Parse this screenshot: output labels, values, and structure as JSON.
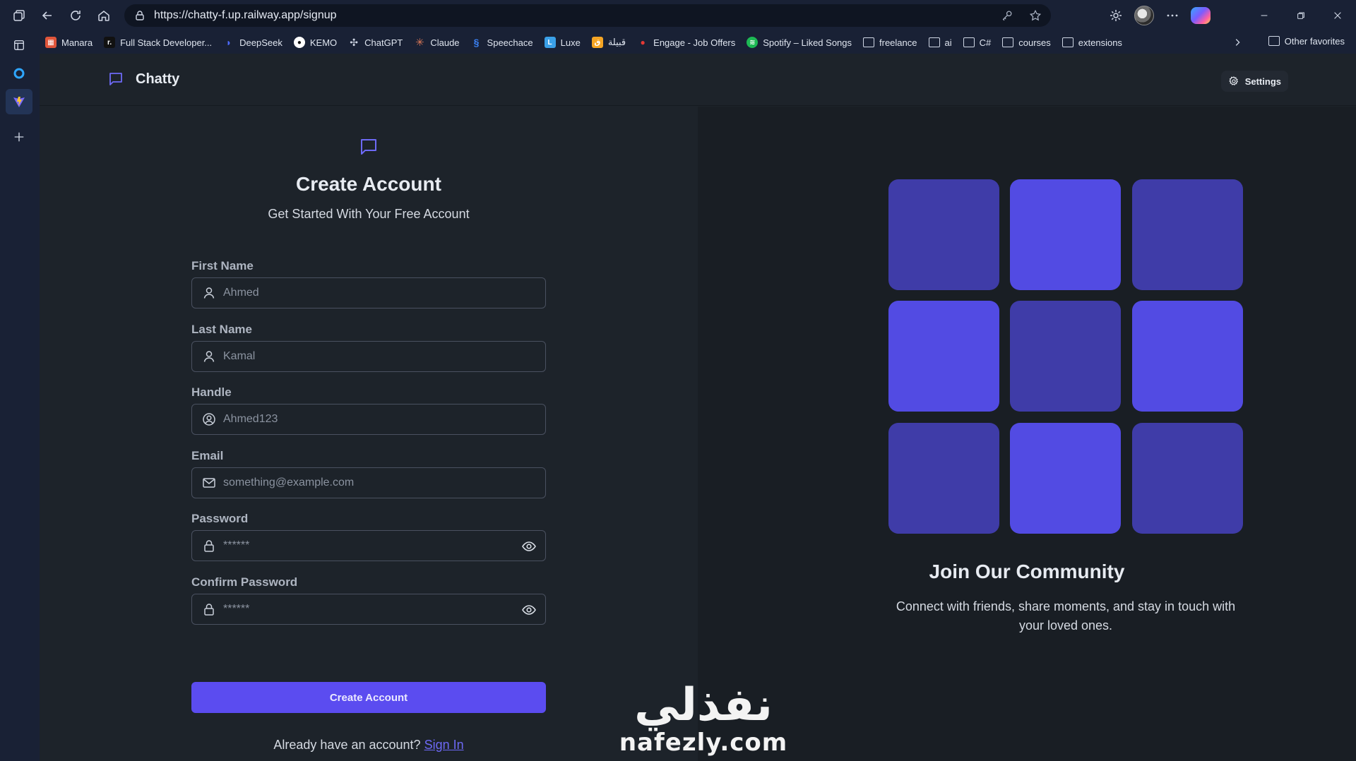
{
  "browser": {
    "url": "https://chatty-f.up.railway.app/signup",
    "bookmarks": [
      {
        "label": "Manara",
        "icon": "manara-icon",
        "color": "#e0553a"
      },
      {
        "label": "Full Stack Developer...",
        "icon": "r-icon",
        "color": "#111111"
      },
      {
        "label": "DeepSeek",
        "icon": "deepseek-icon",
        "color": "#4d6bfe"
      },
      {
        "label": "KEMO",
        "icon": "github-icon",
        "color": "#ffffff"
      },
      {
        "label": "ChatGPT",
        "icon": "chatgpt-icon",
        "color": "#cfd6e4"
      },
      {
        "label": "Claude",
        "icon": "claude-icon",
        "color": "#d97757"
      },
      {
        "label": "Speechace",
        "icon": "speechace-icon",
        "color": "#3b82f6"
      },
      {
        "label": "Luxe",
        "icon": "luxe-icon",
        "color": "#3aa0e8"
      },
      {
        "label": "قبيلة",
        "icon": "qabila-icon",
        "color": "#f5a524"
      },
      {
        "label": "Engage - Job Offers",
        "icon": "engage-icon",
        "color": "#e53935"
      },
      {
        "label": "Spotify – Liked Songs",
        "icon": "spotify-icon",
        "color": "#1db954"
      },
      {
        "label": "freelance",
        "icon": "folder-icon"
      },
      {
        "label": "ai",
        "icon": "folder-icon"
      },
      {
        "label": "C#",
        "icon": "folder-icon"
      },
      {
        "label": "courses",
        "icon": "folder-icon"
      },
      {
        "label": "extensions",
        "icon": "folder-icon"
      }
    ],
    "other_favorites": "Other favorites"
  },
  "nav": {
    "brand": "Chatty",
    "settings": "Settings"
  },
  "form": {
    "title": "Create Account",
    "subtitle": "Get Started With Your Free Account",
    "first_name": {
      "label": "First Name",
      "placeholder": "Ahmed"
    },
    "last_name": {
      "label": "Last Name",
      "placeholder": "Kamal"
    },
    "handle": {
      "label": "Handle",
      "placeholder": "Ahmed123"
    },
    "email": {
      "label": "Email",
      "placeholder": "something@example.com"
    },
    "password": {
      "label": "Password",
      "placeholder": "******"
    },
    "confirm_password": {
      "label": "Confirm Password",
      "placeholder": "******"
    },
    "submit": "Create Account",
    "have_account": "Already have an account?",
    "sign_in": "Sign In"
  },
  "community": {
    "title": "Join Our Community",
    "text": "Connect with friends, share moments, and stay in touch with your loved ones.",
    "tile_colors": [
      "#3f3ca8",
      "#524be3",
      "#3f3ca8",
      "#524be3",
      "#3f3ca8",
      "#524be3",
      "#3f3ca8",
      "#524be3",
      "#3f3ca8"
    ]
  },
  "watermark": {
    "arabic": "نفذلي",
    "latin": "nafezly.com"
  },
  "colors": {
    "primary": "#5b4cf0",
    "accent": "#6d69f5",
    "background": "#1d232a"
  }
}
